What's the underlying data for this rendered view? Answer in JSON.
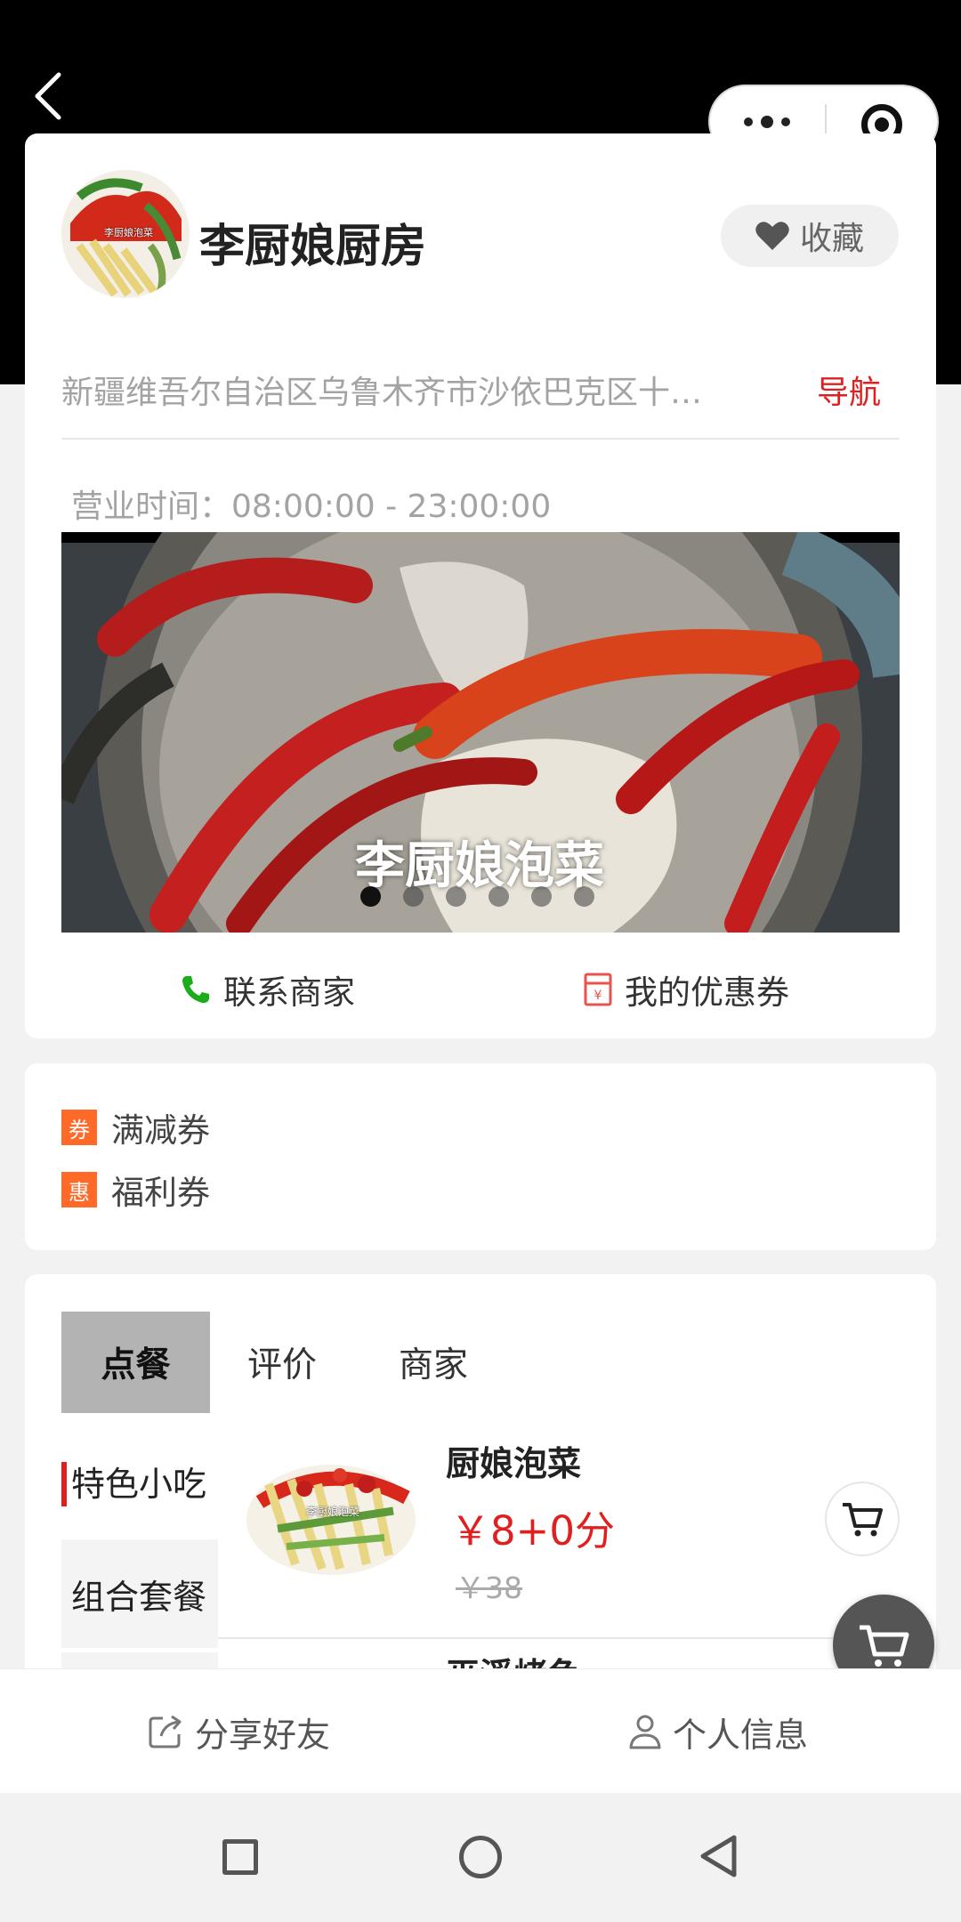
{
  "shop": {
    "name": "李厨娘厨房",
    "avatar_text": "李厨娘泡菜",
    "favorite_label": "收藏",
    "address": "新疆维吾尔自治区乌鲁木齐市沙依巴克区十…",
    "nav_label": "导航",
    "hours": "营业时间：08:00:00 - 23:00:00",
    "banner_caption": "李厨娘泡菜",
    "banner_slide_count": 6,
    "banner_active_slide": 1,
    "contact_label": "联系商家",
    "coupon_label": "我的优惠券"
  },
  "coupons": {
    "items": [
      {
        "tag": "券",
        "label": "满减券"
      },
      {
        "tag": "惠",
        "label": "福利券"
      }
    ]
  },
  "menu": {
    "tabs": [
      "点餐",
      "评价",
      "商家"
    ],
    "categories": [
      "特色小吃",
      "组合套餐"
    ],
    "dishes": [
      {
        "name": "厨娘泡菜",
        "price": "￥8+0分",
        "original_price": "￥38",
        "image_text": "李厨娘泡菜"
      },
      {
        "name": "巫溪烤鱼"
      }
    ]
  },
  "bottom_bar": {
    "share_label": "分享好友",
    "profile_label": "个人信息"
  },
  "colors": {
    "accent_red": "#e02020",
    "coupon_orange": "#ff6a28",
    "phone_green": "#1aad19"
  },
  "icons": [
    "back-icon",
    "more-icon",
    "close-icon",
    "heart-icon",
    "phone-icon",
    "coupon-icon",
    "cart-icon",
    "share-icon",
    "person-icon"
  ]
}
